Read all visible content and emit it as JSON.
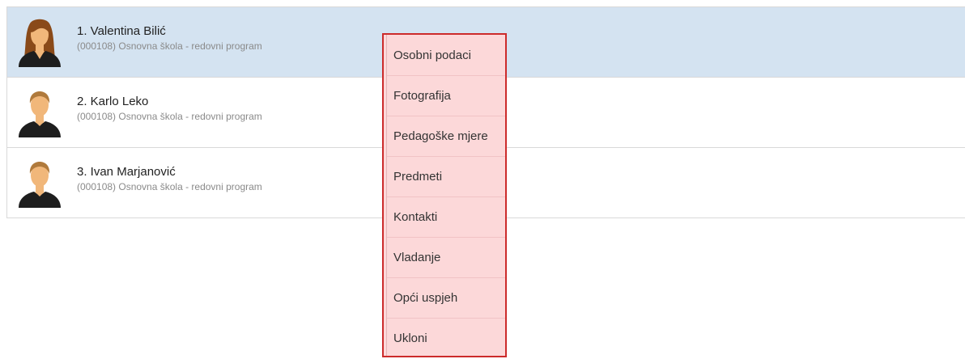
{
  "students": [
    {
      "name": "1. Valentina Bilić",
      "program": "(000108) Osnovna škola - redovni program",
      "avatar": "female-avatar-icon",
      "selected": true
    },
    {
      "name": "2. Karlo Leko",
      "program": "(000108) Osnovna škola - redovni program",
      "avatar": "male-avatar-icon",
      "selected": false
    },
    {
      "name": "3. Ivan Marjanović",
      "program": "(000108) Osnovna škola - redovni program",
      "avatar": "male-avatar-icon",
      "selected": false
    }
  ],
  "context_menu": {
    "items": [
      {
        "label": "Osobni podaci"
      },
      {
        "label": "Fotografija"
      },
      {
        "label": "Pedagoške mjere"
      },
      {
        "label": "Predmeti"
      },
      {
        "label": "Kontakti"
      },
      {
        "label": "Vladanje"
      },
      {
        "label": "Opći uspjeh"
      },
      {
        "label": "Ukloni"
      }
    ]
  },
  "colors": {
    "selected_row": "#d4e3f1",
    "menu_background": "#fcd8d9",
    "menu_border": "#cc2b2b",
    "skin": "#f1b77a",
    "female_hair": "#8a4a19",
    "male_hair": "#b07a3c",
    "clothing": "#1e1e1e"
  }
}
